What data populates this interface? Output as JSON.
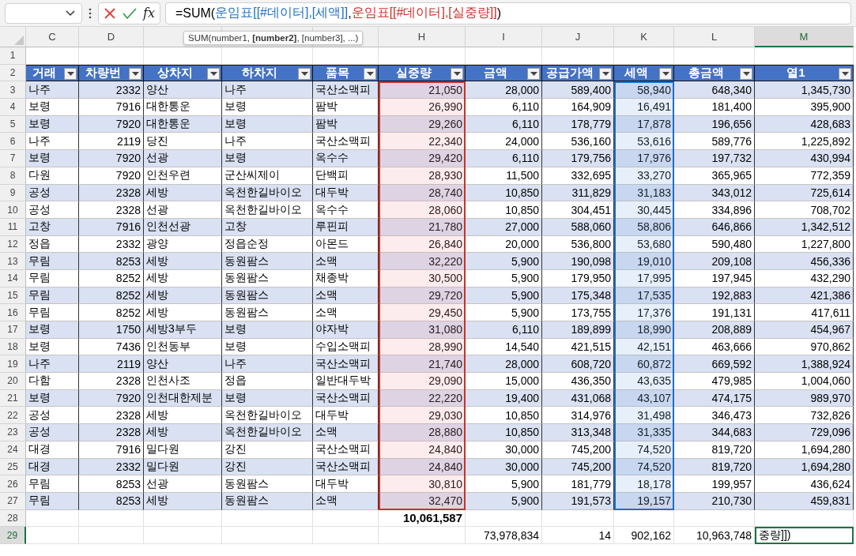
{
  "formula_bar": {
    "function_button": "fx",
    "parts": [
      {
        "text": "=SUM("
      },
      {
        "text": "운임표[[#데이터],[세액]]",
        "color": "#1f6fc4"
      },
      {
        "text": ","
      },
      {
        "text": "운임표[[#데이터],[실중량]]",
        "color": "#c8312b"
      },
      {
        "text": ")"
      }
    ]
  },
  "tooltip": "SUM(number1, **[number2]**, [number3], ...)",
  "columns": [
    {
      "letter": "C",
      "selected": false
    },
    {
      "letter": "D",
      "selected": false
    },
    {
      "selected": false
    },
    {
      "selected": false
    },
    {
      "selected": false
    },
    {
      "letter": "H",
      "selected": false
    },
    {
      "letter": "I",
      "selected": false
    },
    {
      "letter": "J",
      "selected": false
    },
    {
      "letter": "K",
      "selected": false
    },
    {
      "letter": "L",
      "selected": false
    },
    {
      "letter": "M",
      "selected": true
    }
  ],
  "row_numbers": [
    {
      "label": "1",
      "selected": false
    },
    {
      "label": "2",
      "selected": false
    },
    {
      "label": "3",
      "selected": false
    },
    {
      "label": "4",
      "selected": false
    },
    {
      "label": "5",
      "selected": false
    },
    {
      "label": "6",
      "selected": false
    },
    {
      "label": "7",
      "selected": false
    },
    {
      "label": "8",
      "selected": false
    },
    {
      "label": "9",
      "selected": false
    },
    {
      "label": "10",
      "selected": false
    },
    {
      "label": "11",
      "selected": false
    },
    {
      "label": "12",
      "selected": false
    },
    {
      "label": "13",
      "selected": false
    },
    {
      "label": "14",
      "selected": false
    },
    {
      "label": "15",
      "selected": false
    },
    {
      "label": "16",
      "selected": false
    },
    {
      "label": "17",
      "selected": false
    },
    {
      "label": "18",
      "selected": false
    },
    {
      "label": "19",
      "selected": false
    },
    {
      "label": "20",
      "selected": false
    },
    {
      "label": "21",
      "selected": false
    },
    {
      "label": "22",
      "selected": false
    },
    {
      "label": "23",
      "selected": false
    },
    {
      "label": "24",
      "selected": false
    },
    {
      "label": "25",
      "selected": false
    },
    {
      "label": "26",
      "selected": false
    },
    {
      "label": "27",
      "selected": false
    },
    {
      "label": "28",
      "selected": false
    },
    {
      "label": "29",
      "selected": true
    }
  ],
  "table": {
    "headers": [
      {
        "label": "거래",
        "numeric": false
      },
      {
        "label": "차량번",
        "numeric": true
      },
      {
        "label": "상차지",
        "numeric": false
      },
      {
        "label": "하차지",
        "numeric": false
      },
      {
        "label": "품목",
        "numeric": false
      },
      {
        "label": "실중량",
        "numeric": true,
        "color": "#c8312b"
      },
      {
        "label": "금액",
        "numeric": true
      },
      {
        "label": "공급가액",
        "numeric": true
      },
      {
        "label": "세액",
        "numeric": true,
        "color": "#1f6fc4"
      },
      {
        "label": "총금액",
        "numeric": true
      },
      {
        "label": "열1",
        "numeric": true
      }
    ],
    "rows": [
      [
        "나주",
        "2332",
        "양산",
        "나주",
        "국산소맥피",
        "21,050",
        "28,000",
        "589,400",
        "58,940",
        "648,340",
        "1,345,730"
      ],
      [
        "보령",
        "7916",
        "대한통운",
        "보령",
        "팜박",
        "26,990",
        "6,110",
        "164,909",
        "16,491",
        "181,400",
        "395,900"
      ],
      [
        "보령",
        "7920",
        "대한통운",
        "보령",
        "팜박",
        "29,260",
        "6,110",
        "178,779",
        "17,878",
        "196,656",
        "428,683"
      ],
      [
        "나주",
        "2119",
        "당진",
        "나주",
        "국산소맥피",
        "22,340",
        "24,000",
        "536,160",
        "53,616",
        "589,776",
        "1,225,892"
      ],
      [
        "보령",
        "7920",
        "선광",
        "보령",
        "옥수수",
        "29,420",
        "6,110",
        "179,756",
        "17,976",
        "197,732",
        "430,994"
      ],
      [
        "다원",
        "7920",
        "인천우련",
        "군산씨제이",
        "단백피",
        "28,930",
        "11,500",
        "332,695",
        "33,270",
        "365,965",
        "772,359"
      ],
      [
        "공성",
        "2328",
        "세방",
        "옥천한길바이오",
        "대두박",
        "28,740",
        "10,850",
        "311,829",
        "31,183",
        "343,012",
        "725,614"
      ],
      [
        "공성",
        "2328",
        "선광",
        "옥천한길바이오",
        "옥수수",
        "28,060",
        "10,850",
        "304,451",
        "30,445",
        "334,896",
        "708,702"
      ],
      [
        "고창",
        "7916",
        "인천선광",
        "고창",
        "루핀피",
        "21,780",
        "27,000",
        "588,060",
        "58,806",
        "646,866",
        "1,342,512"
      ],
      [
        "정읍",
        "2332",
        "광양",
        "정읍순정",
        "아몬드",
        "26,840",
        "20,000",
        "536,800",
        "53,680",
        "590,480",
        "1,227,800"
      ],
      [
        "무림",
        "8253",
        "세방",
        "동원팜스",
        "소맥",
        "32,220",
        "5,900",
        "190,098",
        "19,010",
        "209,108",
        "456,336"
      ],
      [
        "무림",
        "8252",
        "세방",
        "동원팜스",
        "채종박",
        "30,500",
        "5,900",
        "179,950",
        "17,995",
        "197,945",
        "432,290"
      ],
      [
        "무림",
        "8252",
        "세방",
        "동원팜스",
        "소맥",
        "29,720",
        "5,900",
        "175,348",
        "17,535",
        "192,883",
        "421,386"
      ],
      [
        "무림",
        "8252",
        "세방",
        "동원팜스",
        "소맥",
        "29,450",
        "5,900",
        "173,755",
        "17,376",
        "191,131",
        "417,611"
      ],
      [
        "보령",
        "1750",
        "세방3부두",
        "보령",
        "야자박",
        "31,080",
        "6,110",
        "189,899",
        "18,990",
        "208,889",
        "454,967"
      ],
      [
        "보령",
        "7436",
        "인천동부",
        "보령",
        "수입소맥피",
        "28,990",
        "14,540",
        "421,515",
        "42,151",
        "463,666",
        "970,862"
      ],
      [
        "나주",
        "2119",
        "양산",
        "나주",
        "국산소맥피",
        "21,740",
        "28,000",
        "608,720",
        "60,872",
        "669,592",
        "1,388,924"
      ],
      [
        "다함",
        "2328",
        "인천사조",
        "정읍",
        "일반대두박",
        "29,090",
        "15,000",
        "436,350",
        "43,635",
        "479,985",
        "1,004,060"
      ],
      [
        "보령",
        "7920",
        "인천대한제분",
        "보령",
        "국산소맥피",
        "22,220",
        "19,400",
        "431,068",
        "43,107",
        "474,175",
        "989,970"
      ],
      [
        "공성",
        "2328",
        "세방",
        "옥천한길바이오",
        "대두박",
        "29,030",
        "10,850",
        "314,976",
        "31,498",
        "346,473",
        "732,826"
      ],
      [
        "공성",
        "2328",
        "세방",
        "옥천한길바이오",
        "소맥",
        "28,880",
        "10,850",
        "313,348",
        "31,335",
        "344,683",
        "729,096"
      ],
      [
        "대경",
        "7916",
        "밀다원",
        "강진",
        "국산소맥피",
        "24,840",
        "30,000",
        "745,200",
        "74,520",
        "819,720",
        "1,694,280"
      ],
      [
        "대경",
        "2332",
        "밀다원",
        "강진",
        "국산소맥피",
        "24,840",
        "30,000",
        "745,200",
        "74,520",
        "819,720",
        "1,694,280"
      ],
      [
        "무림",
        "8253",
        "선광",
        "동원팜스",
        "대두박",
        "30,810",
        "5,900",
        "181,779",
        "18,178",
        "199,957",
        "436,624"
      ],
      [
        "무림",
        "8253",
        "세방",
        "동원팜스",
        "소맥",
        "32,470",
        "5,900",
        "191,573",
        "19,157",
        "210,730",
        "459,831"
      ]
    ]
  },
  "totals": [
    [
      {
        "kind": "blank"
      },
      {
        "kind": "blank"
      },
      {
        "kind": "blank"
      },
      {
        "kind": "blank"
      },
      {
        "kind": "blank"
      },
      {
        "kind": "value",
        "text": "10,061,587",
        "bold": true
      },
      {
        "kind": "blank"
      },
      {
        "kind": "blank"
      },
      {
        "kind": "blank"
      },
      {
        "kind": "blank"
      },
      {
        "kind": "blank"
      }
    ],
    [
      {
        "kind": "blank"
      },
      {
        "kind": "blank"
      },
      {
        "kind": "blank"
      },
      {
        "kind": "blank"
      },
      {
        "kind": "blank"
      },
      {
        "kind": "blank"
      },
      {
        "kind": "value",
        "text": "73,978,834"
      },
      {
        "kind": "value",
        "text": "14"
      },
      {
        "kind": "value",
        "text": "902,162"
      },
      {
        "kind": "value",
        "text": "10,963,748"
      },
      {
        "kind": "value",
        "text": "중량]])",
        "editing": true
      }
    ]
  ]
}
